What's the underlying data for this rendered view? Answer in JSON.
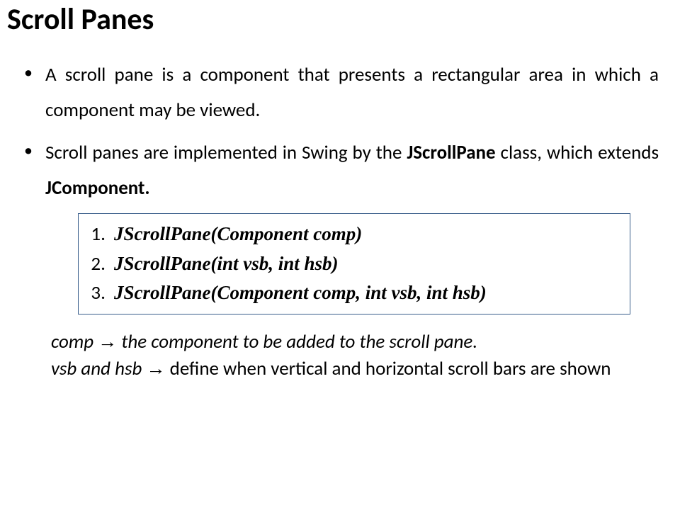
{
  "title": "Scroll Panes",
  "bullets": {
    "b1": "A scroll pane is a component that presents a rectangular area in which a component may be viewed.",
    "b2_pre": "Scroll panes are implemented in Swing by the ",
    "b2_bold1": "JScrollPane",
    "b2_mid": " class, which extends  ",
    "b2_bold2": "JComponent."
  },
  "constructors": {
    "c1": "JScrollPane(Component comp)",
    "c2": "JScrollPane(int vsb, int hsb)",
    "c3": "JScrollPane(Component comp, int vsb, int hsb)"
  },
  "notes": {
    "line1_term": "comp ",
    "arrow": "→",
    "line1_rest": " the component to be added to the scroll pane.",
    "line2_term": "vsb and hsb ",
    "line2_rest": "  define when vertical and horizontal scroll bars are shown"
  }
}
